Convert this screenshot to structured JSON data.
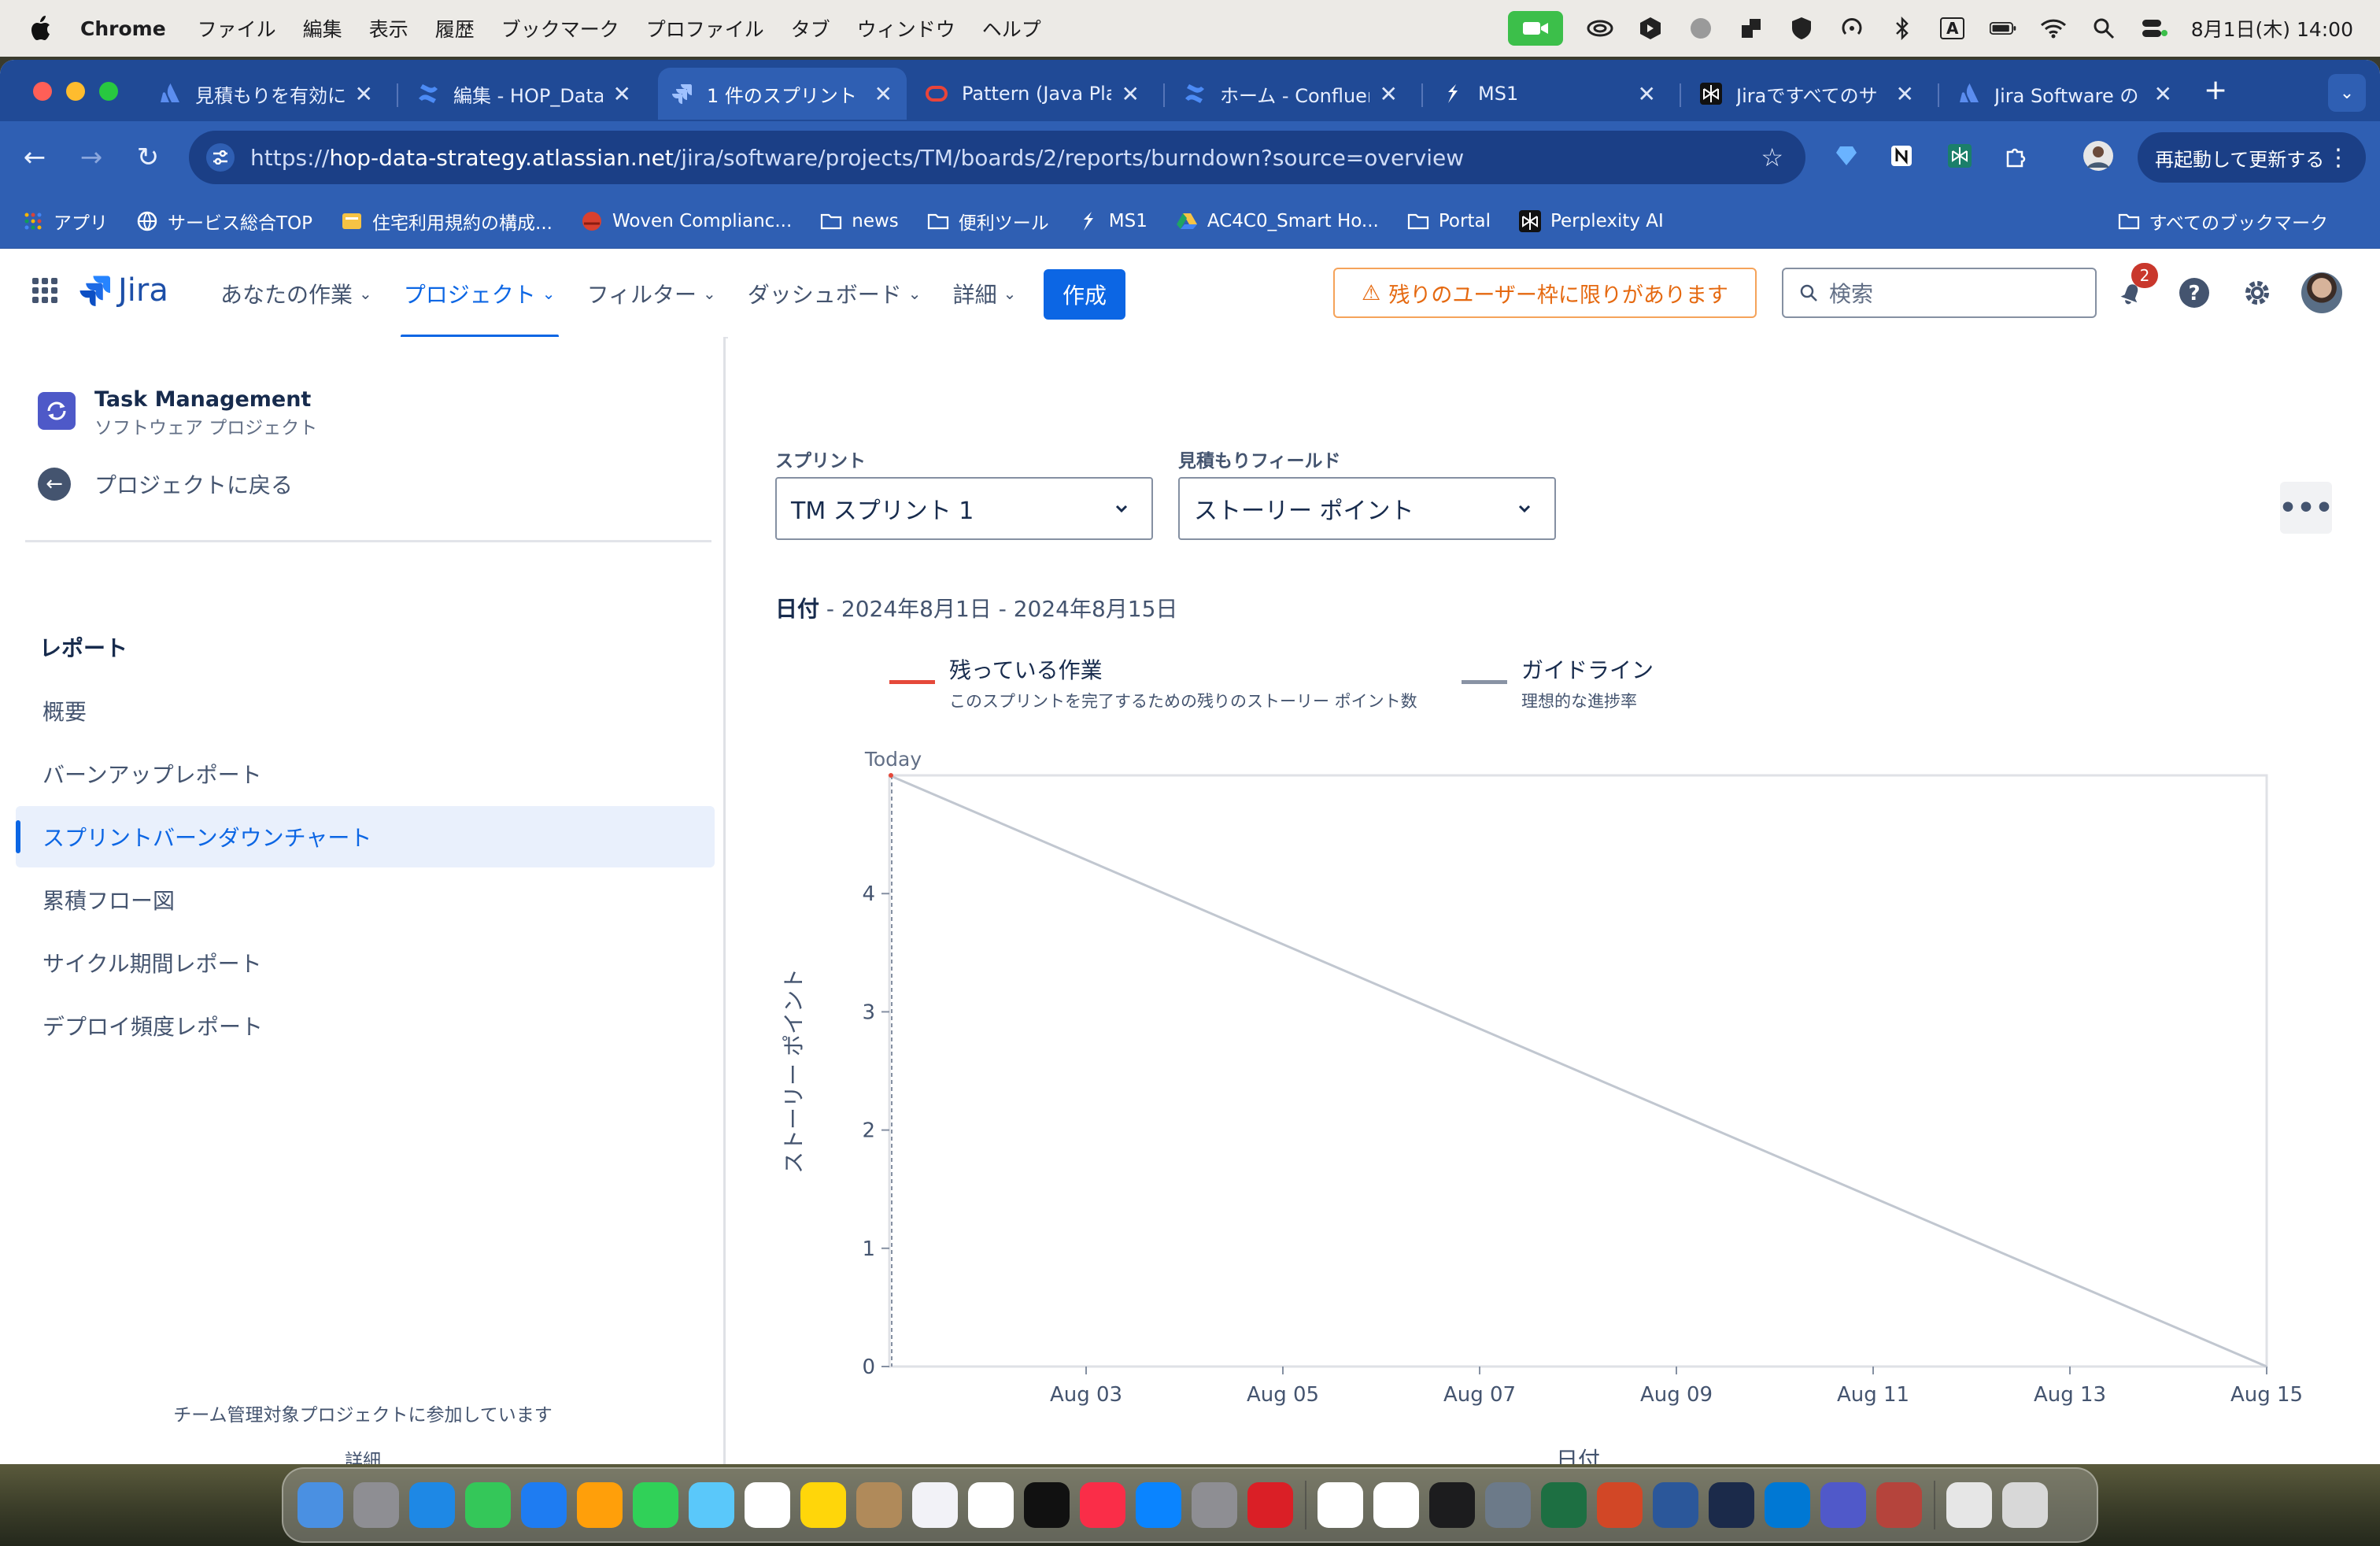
{
  "menubar": {
    "app_name": "Chrome",
    "items": [
      "ファイル",
      "編集",
      "表示",
      "履歴",
      "ブックマーク",
      "プロファイル",
      "タブ",
      "ウィンドウ",
      "ヘルプ"
    ],
    "clock": "8月1日(木)  14:00",
    "input_mode": "A"
  },
  "tabs": [
    {
      "title": "見積もりを有効に",
      "icon": "atlassian-icon"
    },
    {
      "title": "編集 - HOP_Data",
      "icon": "confluence-icon"
    },
    {
      "title": "1 件のスプリント",
      "icon": "jira-icon",
      "active": true
    },
    {
      "title": "Pattern (Java Pla",
      "icon": "oracle-icon"
    },
    {
      "title": "ホーム - Confluen",
      "icon": "confluence-icon"
    },
    {
      "title": "MS1",
      "icon": "ms1-icon"
    },
    {
      "title": "Jiraですべてのサ",
      "icon": "perplexity-icon"
    },
    {
      "title": "Jira Software の",
      "icon": "atlassian-icon"
    }
  ],
  "toolbar": {
    "url_prefix": "https://",
    "url_host": "hop-data-strategy.atlassian.net",
    "url_path": "/jira/software/projects/TM/boards/2/reports/burndown?source=overview",
    "relaunch_label": "再起動して更新する"
  },
  "bookmarks": [
    {
      "label": "アプリ",
      "icon": "apps-grid-icon"
    },
    {
      "label": "サービス総合TOP",
      "icon": "globe-icon"
    },
    {
      "label": "住宅利用規約の構成...",
      "icon": "doc-yellow-icon"
    },
    {
      "label": "Woven Complianc...",
      "icon": "red-circle-icon"
    },
    {
      "label": "news",
      "icon": "folder-icon"
    },
    {
      "label": "便利ツール",
      "icon": "folder-icon"
    },
    {
      "label": "MS1",
      "icon": "ms1-icon"
    },
    {
      "label": "AC4C0_Smart Ho...",
      "icon": "drive-icon"
    },
    {
      "label": "Portal",
      "icon": "folder-icon"
    },
    {
      "label": "Perplexity AI",
      "icon": "perplexity-icon"
    }
  ],
  "bookmarks_all": "すべてのブックマーク",
  "jira": {
    "logo": "Jira",
    "nav": [
      {
        "label": "あなたの作業",
        "active": false
      },
      {
        "label": "プロジェクト",
        "active": true
      },
      {
        "label": "フィルター",
        "active": false
      },
      {
        "label": "ダッシュボード",
        "active": false
      },
      {
        "label": "詳細",
        "active": false
      }
    ],
    "create_label": "作成",
    "warning": "残りのユーザー枠に限りがあります",
    "search_placeholder": "検索",
    "notifications_count": "2"
  },
  "sidebar": {
    "project_name": "Task Management",
    "project_type": "ソフトウェア プロジェクト",
    "back_label": "プロジェクトに戻る",
    "section_title": "レポート",
    "items": [
      {
        "label": "概要",
        "active": false
      },
      {
        "label": "バーンアップレポート",
        "active": false
      },
      {
        "label": "スプリントバーンダウンチャート",
        "active": true
      },
      {
        "label": "累積フロー図",
        "active": false
      },
      {
        "label": "サイクル期間レポート",
        "active": false
      },
      {
        "label": "デプロイ頻度レポート",
        "active": false
      }
    ],
    "footer_text": "チーム管理対象プロジェクトに参加しています",
    "footer_link": "詳細"
  },
  "main": {
    "sprint_label": "スプリント",
    "sprint_value": "TM スプリント 1",
    "estimate_label": "見積もりフィールド",
    "estimate_value": "ストーリー ポイント",
    "date_label": "日付",
    "date_range": " - 2024年8月1日 - 2024年8月15日"
  },
  "chart_data": {
    "type": "line",
    "xlabel": "日付",
    "ylabel": "ストーリー ポイント",
    "ylim": [
      0,
      5
    ],
    "yticks": [
      0,
      1,
      2,
      3,
      4
    ],
    "xlim": [
      "2024-08-01",
      "2024-08-15"
    ],
    "xticks": [
      "Aug 03",
      "Aug 05",
      "Aug 07",
      "Aug 09",
      "Aug 11",
      "Aug 13",
      "Aug 15"
    ],
    "today_marker": {
      "label": "Today",
      "x": "2024-08-01"
    },
    "legend": [
      {
        "name": "残っている作業",
        "description": "このスプリントを完了するための残りのストーリー ポイント数",
        "color": "#e5493a"
      },
      {
        "name": "ガイドライン",
        "description": "理想的な進捗率",
        "color": "#8993a4"
      }
    ],
    "series": [
      {
        "name": "ガイドライン",
        "color": "#c1c7d0",
        "x": [
          "2024-08-01",
          "2024-08-15"
        ],
        "values": [
          5,
          0
        ]
      },
      {
        "name": "残っている作業",
        "color": "#e5493a",
        "x": [
          "2024-08-01"
        ],
        "values": [
          5
        ]
      }
    ]
  },
  "dock": [
    "finder",
    "launchpad",
    "safari",
    "messages",
    "mail",
    "photos",
    "facetime",
    "maps",
    "calendar",
    "notes",
    "contacts",
    "reminders",
    "freeform",
    "tv",
    "music",
    "app-store",
    "system-settings",
    "creative-cloud",
    "chrome",
    "slack",
    "terminal",
    "jamf",
    "excel",
    "powerpoint",
    "word",
    "cursor",
    "vscode",
    "teams",
    "kotoeri",
    "preview",
    "trash"
  ]
}
